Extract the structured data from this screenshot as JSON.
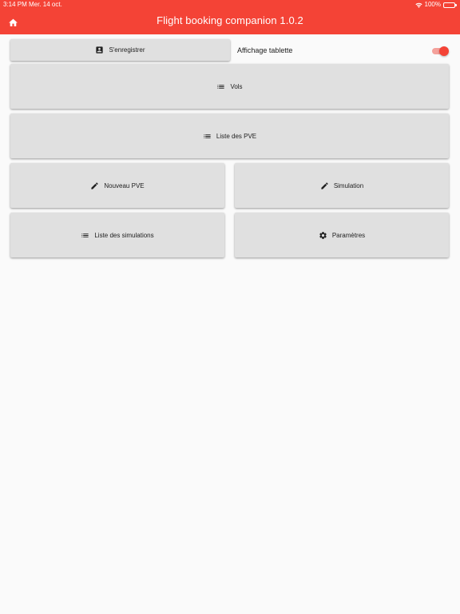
{
  "status_bar": {
    "time": "3:14 PM",
    "date": "Mer. 14 oct.",
    "battery": "100%"
  },
  "app_bar": {
    "title": "Flight booking companion 1.0.2",
    "color": "#f44336"
  },
  "buttons": {
    "register": {
      "label": "S'enregistrer",
      "icon": "contact-card-icon"
    },
    "flights": {
      "label": "Vols",
      "icon": "list-icon"
    },
    "pve_list": {
      "label": "Liste des PVE",
      "icon": "list-icon"
    },
    "new_pve": {
      "label": "Nouveau PVE",
      "icon": "pencil-icon"
    },
    "simulation": {
      "label": "Simulation",
      "icon": "pencil-icon"
    },
    "simulation_list": {
      "label": "Liste des simulations",
      "icon": "list-icon"
    },
    "settings": {
      "label": "Paramètres",
      "icon": "gear-icon"
    }
  },
  "tablet_display": {
    "label": "Affichage tablette",
    "enabled": true
  },
  "colors": {
    "accent": "#f44336",
    "button_bg": "#e0e0e0",
    "page_bg": "#fafafa"
  }
}
